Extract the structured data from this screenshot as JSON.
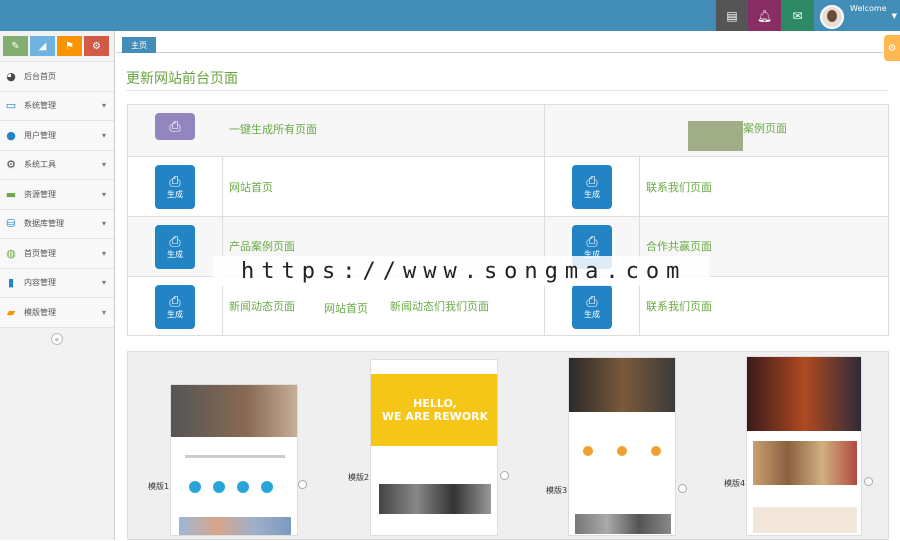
{
  "topbar": {
    "welcome": "Welcome",
    "buttons": [
      {
        "icon": "tasks-icon",
        "color": "#555555"
      },
      {
        "icon": "bell-icon",
        "color": "#892e65"
      },
      {
        "icon": "envelope-icon",
        "color": "#2e8965"
      }
    ],
    "bg": "#438eb9"
  },
  "sidebar": {
    "shortcuts": [
      {
        "icon": "pencil-icon",
        "color": "#82af6f"
      },
      {
        "icon": "signal-icon",
        "color": "#6fb3e0"
      },
      {
        "icon": "flag-icon",
        "color": "#f89406"
      },
      {
        "icon": "cogs-icon",
        "color": "#d15b47"
      }
    ],
    "items": [
      {
        "label": "后台首页",
        "icon": "dashboard-icon",
        "chevron": false
      },
      {
        "label": "系统管理",
        "icon": "desktop-icon",
        "chevron": true
      },
      {
        "label": "用户管理",
        "icon": "users-icon",
        "chevron": true
      },
      {
        "label": "系统工具",
        "icon": "cog-icon",
        "chevron": true
      },
      {
        "label": "资源管理",
        "icon": "credit-card-icon",
        "chevron": true
      },
      {
        "label": "数据库管理",
        "icon": "database-icon",
        "chevron": true
      },
      {
        "label": "首页管理",
        "icon": "globe-icon",
        "chevron": true
      },
      {
        "label": "内容管理",
        "icon": "book-icon",
        "chevron": true
      },
      {
        "label": "模版管理",
        "icon": "folder-icon",
        "chevron": true
      }
    ]
  },
  "breadcrumb": {
    "tab": "主页"
  },
  "main": {
    "title": "更新网站前台页面",
    "generate_label": "生成",
    "rows": [
      {
        "left": "一键生成所有页面",
        "right": "案例页面"
      },
      {
        "left": "网站首页",
        "right": "联系我们页面"
      },
      {
        "left": "产品案例页面",
        "right": "合作共赢页面"
      },
      {
        "left": "新闻动态页面",
        "middle": "新闻动态们我们页面",
        "right": "联系我们页面"
      }
    ],
    "stray_labels": {
      "overlay_a": "网站首页"
    }
  },
  "watermark": "https://www.songma.com",
  "templates": [
    {
      "label": "模版1"
    },
    {
      "label": "模版2",
      "hero_line1": "HELLO,",
      "hero_line2": "WE ARE REWORK"
    },
    {
      "label": "模版3"
    },
    {
      "label": "模版4"
    }
  ]
}
